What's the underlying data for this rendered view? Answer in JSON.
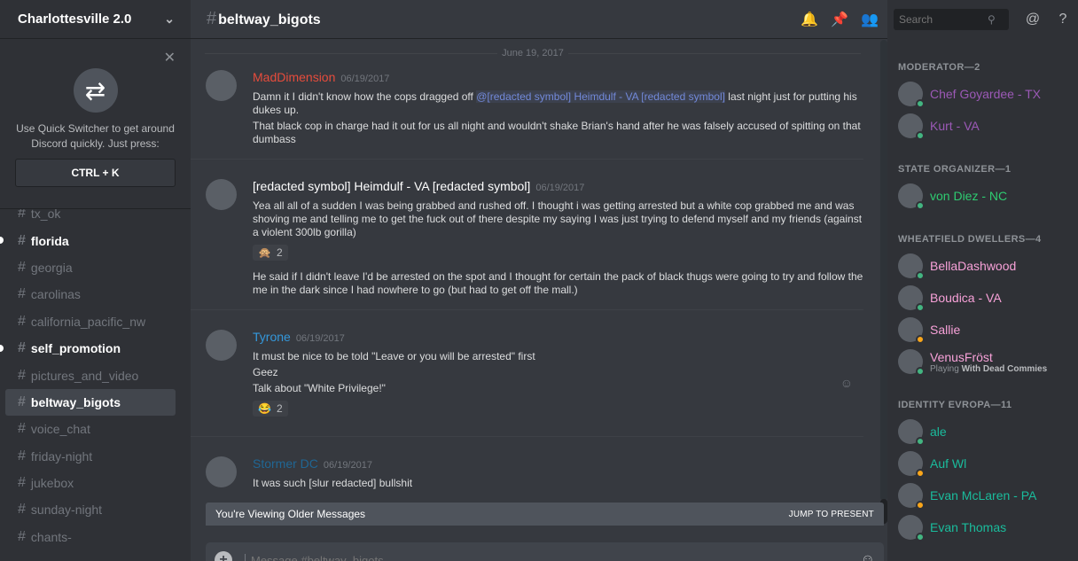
{
  "server": {
    "name": "Charlottesville 2.0"
  },
  "quick_switcher": {
    "text": "Use Quick Switcher to get around Discord quickly. Just press:",
    "shortcut": "CTRL + K"
  },
  "channels": [
    {
      "name": "tx_ok",
      "state": "read"
    },
    {
      "name": "florida",
      "state": "unread"
    },
    {
      "name": "georgia",
      "state": "read"
    },
    {
      "name": "carolinas",
      "state": "read"
    },
    {
      "name": "california_pacific_nw",
      "state": "read"
    },
    {
      "name": "self_promotion",
      "state": "unread"
    },
    {
      "name": "pictures_and_video",
      "state": "read"
    },
    {
      "name": "beltway_bigots",
      "state": "active"
    },
    {
      "name": "voice_chat",
      "state": "read"
    },
    {
      "name": "friday-night",
      "state": "read"
    },
    {
      "name": "jukebox",
      "state": "read"
    },
    {
      "name": "sunday-night",
      "state": "read"
    },
    {
      "name": "chants-",
      "state": "read"
    }
  ],
  "topbar": {
    "channel": "beltway_bigots",
    "search_placeholder": "Search"
  },
  "date_divider": "June 19, 2017",
  "messages": [
    {
      "author": "MadDimension",
      "color": "#e74c3c",
      "time": "06/19/2017",
      "lines": [
        {
          "pre": "Damn it I didn't know how the cops dragged off ",
          "mention": "@[redacted symbol] Heimdulf - VA [redacted symbol]",
          "post": " last night just for putting his dukes up."
        },
        {
          "text": "That black cop in charge had it out for us all night and wouldn't shake Brian's hand after he was falsely accused of spitting on that dumbass"
        }
      ]
    },
    {
      "author": "[redacted symbol] Heimdulf - VA [redacted symbol]",
      "color": "#ffffff",
      "time": "06/19/2017",
      "lines": [
        {
          "text": "Yea all all of a sudden I was being grabbed and rushed off. I thought i was getting arrested but a white cop grabbed me and was shoving me and telling me to get the fuck out of there despite my saying I was just trying to defend myself and my friends (against a violent 300lb gorilla)"
        }
      ],
      "reaction": {
        "emoji": "🙊",
        "count": "2"
      },
      "lines_after": [
        {
          "text": "He said if I didn't leave I'd be arrested on the spot and I thought for certain the pack of black thugs were going to try and follow the me in the dark since I had nowhere to go (but had to get off the mall.)"
        }
      ]
    },
    {
      "author": "Tyrone",
      "color": "#3498db",
      "time": "06/19/2017",
      "lines": [
        {
          "text": "It must be nice to be told \"Leave or you will be arrested\" first"
        },
        {
          "text": "Geez"
        },
        {
          "text": "Talk about \"White Privilege!\""
        }
      ],
      "reaction": {
        "emoji": "😂",
        "count": "2"
      }
    },
    {
      "author": "Stormer DC",
      "color": "#206694",
      "time": "06/19/2017",
      "lines": [
        {
          "text": "It was such [slur redacted] bullshit"
        }
      ]
    }
  ],
  "older_bar": {
    "label": "You're Viewing Older Messages",
    "jump": "JUMP TO PRESENT"
  },
  "composer": {
    "placeholder": "Message #beltway_bigots"
  },
  "members": [
    {
      "section": "MODERATOR—2",
      "people": [
        {
          "name": "Chef Goyardee - TX",
          "color": "#9b59b6",
          "status": "online"
        },
        {
          "name": "Kurt - VA",
          "color": "#9b59b6",
          "status": "online"
        }
      ]
    },
    {
      "section": "STATE ORGANIZER—1",
      "people": [
        {
          "name": "von Diez - NC",
          "color": "#2ecc71",
          "status": "online"
        }
      ]
    },
    {
      "section": "WHEATFIELD DWELLERS—4",
      "people": [
        {
          "name": "BellaDashwood",
          "color": "#f7a1d8",
          "status": "online"
        },
        {
          "name": "Boudica - VA",
          "color": "#f7a1d8",
          "status": "online"
        },
        {
          "name": "Sallie",
          "color": "#f7a1d8",
          "status": "idle"
        },
        {
          "name": "VenusFröst",
          "color": "#f7a1d8",
          "status": "online",
          "activity_pre": "Playing ",
          "activity": "With Dead Commies"
        }
      ]
    },
    {
      "section": "IDENTITY EVROPA—11",
      "people": [
        {
          "name": "ale",
          "color": "#1abc9c",
          "status": "online"
        },
        {
          "name": "Auf Wl",
          "color": "#1abc9c",
          "status": "idle"
        },
        {
          "name": "Evan McLaren - PA",
          "color": "#1abc9c",
          "status": "idle"
        },
        {
          "name": "Evan Thomas",
          "color": "#1abc9c",
          "status": "online"
        }
      ]
    }
  ]
}
